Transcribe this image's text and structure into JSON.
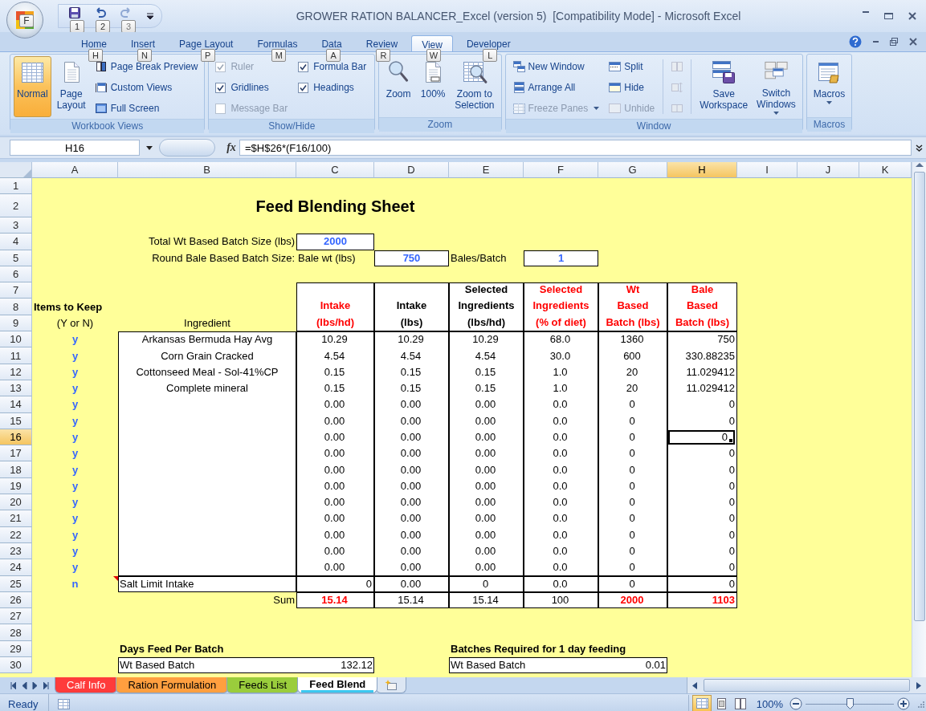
{
  "app_button": {
    "key_tip": "F"
  },
  "quick_access": [
    {
      "key_tip": "1",
      "disabled": false
    },
    {
      "key_tip": "2",
      "disabled": false
    },
    {
      "key_tip": "3",
      "disabled": true
    }
  ],
  "window": {
    "title": "GROWER RATION BALANCER_Excel (version 5)  [Compatibility Mode] - Microsoft Excel"
  },
  "tabs": [
    {
      "label": "Home",
      "key_tip": "H",
      "selected": false
    },
    {
      "label": "Insert",
      "key_tip": "N",
      "selected": false
    },
    {
      "label": "Page Layout",
      "key_tip": "P",
      "selected": false
    },
    {
      "label": "Formulas",
      "key_tip": "M",
      "selected": false
    },
    {
      "label": "Data",
      "key_tip": "A",
      "selected": false
    },
    {
      "label": "Review",
      "key_tip": "R",
      "selected": false
    },
    {
      "label": "View",
      "key_tip": "W",
      "selected": true
    },
    {
      "label": "Developer",
      "key_tip": "L",
      "selected": false
    }
  ],
  "ribbon_groups": [
    {
      "title": "Workbook Views",
      "items": [
        {
          "kind": "large",
          "lines": [
            "Normal"
          ],
          "selected": true,
          "disabled": false,
          "dropdown": false
        },
        {
          "kind": "large",
          "lines": [
            "Page",
            "Layout"
          ],
          "selected": false,
          "disabled": false,
          "dropdown": false
        },
        {
          "kind": "small",
          "label": "Page Break Preview",
          "disabled": false,
          "dropdown": false
        },
        {
          "kind": "small",
          "label": "Custom Views",
          "disabled": false,
          "dropdown": false
        },
        {
          "kind": "small",
          "label": "Full Screen",
          "disabled": false,
          "dropdown": false
        }
      ]
    },
    {
      "title": "Show/Hide",
      "items": [
        {
          "kind": "check",
          "label": "Ruler",
          "checked": true,
          "disabled": true
        },
        {
          "kind": "check",
          "label": "Gridlines",
          "checked": true,
          "disabled": false
        },
        {
          "kind": "check",
          "label": "Message Bar",
          "checked": false,
          "disabled": true
        },
        {
          "kind": "check",
          "label": "Formula Bar",
          "checked": true,
          "disabled": false
        },
        {
          "kind": "check",
          "label": "Headings",
          "checked": true,
          "disabled": false
        }
      ]
    },
    {
      "title": "Zoom",
      "items": [
        {
          "kind": "large",
          "lines": [
            "Zoom"
          ],
          "disabled": false,
          "dropdown": false
        },
        {
          "kind": "large",
          "lines": [
            "100%"
          ],
          "disabled": false,
          "dropdown": false
        },
        {
          "kind": "large",
          "lines": [
            "Zoom to",
            "Selection"
          ],
          "disabled": false,
          "dropdown": false
        }
      ]
    },
    {
      "title": "Window",
      "items": [
        {
          "kind": "small",
          "label": "New Window",
          "disabled": false,
          "dropdown": false
        },
        {
          "kind": "small",
          "label": "Arrange All",
          "disabled": false,
          "dropdown": false
        },
        {
          "kind": "small",
          "label": "Freeze Panes",
          "disabled": true,
          "dropdown": true
        },
        {
          "kind": "small",
          "label": "Split",
          "disabled": false,
          "dropdown": false
        },
        {
          "kind": "small",
          "label": "Hide",
          "disabled": false,
          "dropdown": false
        },
        {
          "kind": "small",
          "label": "Unhide",
          "disabled": true,
          "dropdown": false
        },
        {
          "kind": "icon",
          "disabled": true
        },
        {
          "kind": "icon",
          "disabled": true
        },
        {
          "kind": "icon",
          "disabled": true
        },
        {
          "kind": "large",
          "lines": [
            "Save",
            "Workspace"
          ],
          "disabled": false,
          "dropdown": false
        },
        {
          "kind": "large",
          "lines": [
            "Switch",
            "Windows"
          ],
          "disabled": false,
          "dropdown": true
        }
      ]
    },
    {
      "title": "Macros",
      "items": [
        {
          "kind": "large",
          "lines": [
            "Macros"
          ],
          "disabled": false,
          "dropdown": true
        }
      ]
    }
  ],
  "formula_bar": {
    "name_box": "H16",
    "function_button": "fx",
    "formula": "=$H$26*(F16/100)"
  },
  "sheet": {
    "columns": [
      {
        "label": "A",
        "selected": false
      },
      {
        "label": "B",
        "selected": false
      },
      {
        "label": "C",
        "selected": false
      },
      {
        "label": "D",
        "selected": false
      },
      {
        "label": "E",
        "selected": false
      },
      {
        "label": "F",
        "selected": false
      },
      {
        "label": "G",
        "selected": false
      },
      {
        "label": "H",
        "selected": true
      },
      {
        "label": "I",
        "selected": false
      },
      {
        "label": "J",
        "selected": false
      },
      {
        "label": "K",
        "selected": false
      }
    ],
    "row_numbers": [
      {
        "label": "1",
        "selected": false
      },
      {
        "label": "2",
        "selected": false
      },
      {
        "label": "3",
        "selected": false
      },
      {
        "label": "4",
        "selected": false
      },
      {
        "label": "5",
        "selected": false
      },
      {
        "label": "6",
        "selected": false
      },
      {
        "label": "7",
        "selected": false
      },
      {
        "label": "8",
        "selected": false
      },
      {
        "label": "9",
        "selected": false
      },
      {
        "label": "10",
        "selected": false
      },
      {
        "label": "11",
        "selected": false
      },
      {
        "label": "12",
        "selected": false
      },
      {
        "label": "13",
        "selected": false
      },
      {
        "label": "14",
        "selected": false
      },
      {
        "label": "15",
        "selected": false
      },
      {
        "label": "16",
        "selected": true
      },
      {
        "label": "17",
        "selected": false
      },
      {
        "label": "18",
        "selected": false
      },
      {
        "label": "19",
        "selected": false
      },
      {
        "label": "20",
        "selected": false
      },
      {
        "label": "21",
        "selected": false
      },
      {
        "label": "22",
        "selected": false
      },
      {
        "label": "23",
        "selected": false
      },
      {
        "label": "24",
        "selected": false
      },
      {
        "label": "25",
        "selected": false
      },
      {
        "label": "26",
        "selected": false
      },
      {
        "label": "27",
        "selected": false
      },
      {
        "label": "28",
        "selected": false
      },
      {
        "label": "29",
        "selected": false
      },
      {
        "label": "30",
        "selected": false
      }
    ],
    "title": "Feed Blending Sheet",
    "batch_size": {
      "label": "Total Wt Based Batch Size (lbs)",
      "value": "2000"
    },
    "bale_batch": {
      "label": "Round Bale Based Batch Size:",
      "weight_label": "Bale wt (lbs)",
      "weight": "750",
      "bales_label": "Bales/Batch",
      "bales": "1"
    },
    "keep_heading": {
      "title": "Items to Keep",
      "hint": "(Y or N)"
    },
    "ingredient_heading": "Ingredient",
    "table_columns": [
      {
        "lines": [
          "Intake",
          "(lbs/hd)"
        ],
        "highlighted": true
      },
      {
        "lines": [
          "Intake",
          "(lbs)"
        ],
        "highlighted": false
      },
      {
        "lines": [
          "Selected",
          "Ingredients",
          "(lbs/hd)"
        ],
        "highlighted": false
      },
      {
        "lines": [
          "Selected",
          "Ingredients",
          "(% of diet)"
        ],
        "highlighted": true
      },
      {
        "lines": [
          "Wt",
          "Based",
          "Batch (lbs)"
        ],
        "highlighted": true
      },
      {
        "lines": [
          "Bale",
          "Based",
          "Batch (lbs)"
        ],
        "highlighted": true
      }
    ],
    "table_rows": [
      {
        "kind": "ingredient",
        "keep": "y",
        "has_comment": false,
        "ingredient": "Arkansas Bermuda Hay Avg",
        "values": [
          {
            "text": "10.29",
            "selected": false
          },
          {
            "text": "10.29",
            "selected": false
          },
          {
            "text": "10.29",
            "selected": false
          },
          {
            "text": "68.0",
            "selected": false
          },
          {
            "text": "1360",
            "selected": false
          },
          {
            "text": "750",
            "selected": false
          }
        ]
      },
      {
        "kind": "ingredient",
        "keep": "y",
        "has_comment": false,
        "ingredient": "Corn Grain Cracked",
        "values": [
          {
            "text": "4.54",
            "selected": false
          },
          {
            "text": "4.54",
            "selected": false
          },
          {
            "text": "4.54",
            "selected": false
          },
          {
            "text": "30.0",
            "selected": false
          },
          {
            "text": "600",
            "selected": false
          },
          {
            "text": "330.88235",
            "selected": false
          }
        ]
      },
      {
        "kind": "ingredient",
        "keep": "y",
        "has_comment": false,
        "ingredient": "Cottonseed Meal - Sol-41%CP",
        "values": [
          {
            "text": "0.15",
            "selected": false
          },
          {
            "text": "0.15",
            "selected": false
          },
          {
            "text": "0.15",
            "selected": false
          },
          {
            "text": "1.0",
            "selected": false
          },
          {
            "text": "20",
            "selected": false
          },
          {
            "text": "11.029412",
            "selected": false
          }
        ]
      },
      {
        "kind": "ingredient",
        "keep": "y",
        "has_comment": false,
        "ingredient": "Complete mineral",
        "values": [
          {
            "text": "0.15",
            "selected": false
          },
          {
            "text": "0.15",
            "selected": false
          },
          {
            "text": "0.15",
            "selected": false
          },
          {
            "text": "1.0",
            "selected": false
          },
          {
            "text": "20",
            "selected": false
          },
          {
            "text": "11.029412",
            "selected": false
          }
        ]
      },
      {
        "kind": "ingredient",
        "keep": "y",
        "has_comment": false,
        "values": [
          {
            "text": "0.00",
            "selected": false
          },
          {
            "text": "0.00",
            "selected": false
          },
          {
            "text": "0.00",
            "selected": false
          },
          {
            "text": "0.0",
            "selected": false
          },
          {
            "text": "0",
            "selected": false
          },
          {
            "text": "0",
            "selected": false
          }
        ]
      },
      {
        "kind": "ingredient",
        "keep": "y",
        "has_comment": false,
        "values": [
          {
            "text": "0.00",
            "selected": false
          },
          {
            "text": "0.00",
            "selected": false
          },
          {
            "text": "0.00",
            "selected": false
          },
          {
            "text": "0.0",
            "selected": false
          },
          {
            "text": "0",
            "selected": false
          },
          {
            "text": "0",
            "selected": false
          }
        ]
      },
      {
        "kind": "ingredient",
        "keep": "y",
        "has_comment": false,
        "values": [
          {
            "text": "0.00",
            "selected": false
          },
          {
            "text": "0.00",
            "selected": false
          },
          {
            "text": "0.00",
            "selected": false
          },
          {
            "text": "0.0",
            "selected": false
          },
          {
            "text": "0",
            "selected": false
          },
          {
            "text": "0",
            "selected": true
          }
        ]
      },
      {
        "kind": "ingredient",
        "keep": "y",
        "has_comment": false,
        "values": [
          {
            "text": "0.00",
            "selected": false
          },
          {
            "text": "0.00",
            "selected": false
          },
          {
            "text": "0.00",
            "selected": false
          },
          {
            "text": "0.0",
            "selected": false
          },
          {
            "text": "0",
            "selected": false
          },
          {
            "text": "0",
            "selected": false
          }
        ]
      },
      {
        "kind": "ingredient",
        "keep": "y",
        "has_comment": false,
        "values": [
          {
            "text": "0.00",
            "selected": false
          },
          {
            "text": "0.00",
            "selected": false
          },
          {
            "text": "0.00",
            "selected": false
          },
          {
            "text": "0.0",
            "selected": false
          },
          {
            "text": "0",
            "selected": false
          },
          {
            "text": "0",
            "selected": false
          }
        ]
      },
      {
        "kind": "ingredient",
        "keep": "y",
        "has_comment": false,
        "values": [
          {
            "text": "0.00",
            "selected": false
          },
          {
            "text": "0.00",
            "selected": false
          },
          {
            "text": "0.00",
            "selected": false
          },
          {
            "text": "0.0",
            "selected": false
          },
          {
            "text": "0",
            "selected": false
          },
          {
            "text": "0",
            "selected": false
          }
        ]
      },
      {
        "kind": "ingredient",
        "keep": "y",
        "has_comment": false,
        "values": [
          {
            "text": "0.00",
            "selected": false
          },
          {
            "text": "0.00",
            "selected": false
          },
          {
            "text": "0.00",
            "selected": false
          },
          {
            "text": "0.0",
            "selected": false
          },
          {
            "text": "0",
            "selected": false
          },
          {
            "text": "0",
            "selected": false
          }
        ]
      },
      {
        "kind": "ingredient",
        "keep": "y",
        "has_comment": false,
        "values": [
          {
            "text": "0.00",
            "selected": false
          },
          {
            "text": "0.00",
            "selected": false
          },
          {
            "text": "0.00",
            "selected": false
          },
          {
            "text": "0.0",
            "selected": false
          },
          {
            "text": "0",
            "selected": false
          },
          {
            "text": "0",
            "selected": false
          }
        ]
      },
      {
        "kind": "ingredient",
        "keep": "y",
        "has_comment": false,
        "values": [
          {
            "text": "0.00",
            "selected": false
          },
          {
            "text": "0.00",
            "selected": false
          },
          {
            "text": "0.00",
            "selected": false
          },
          {
            "text": "0.0",
            "selected": false
          },
          {
            "text": "0",
            "selected": false
          },
          {
            "text": "0",
            "selected": false
          }
        ]
      },
      {
        "kind": "ingredient",
        "keep": "y",
        "has_comment": false,
        "values": [
          {
            "text": "0.00",
            "selected": false
          },
          {
            "text": "0.00",
            "selected": false
          },
          {
            "text": "0.00",
            "selected": false
          },
          {
            "text": "0.0",
            "selected": false
          },
          {
            "text": "0",
            "selected": false
          },
          {
            "text": "0",
            "selected": false
          }
        ]
      },
      {
        "kind": "ingredient",
        "keep": "y",
        "has_comment": false,
        "values": [
          {
            "text": "0.00",
            "selected": false
          },
          {
            "text": "0.00",
            "selected": false
          },
          {
            "text": "0.00",
            "selected": false
          },
          {
            "text": "0.0",
            "selected": false
          },
          {
            "text": "0",
            "selected": false
          },
          {
            "text": "0",
            "selected": false
          }
        ]
      },
      {
        "kind": "limit",
        "keep": "n",
        "has_comment": true,
        "ingredient": "Salt Limit Intake",
        "values": [
          {
            "text": "0",
            "selected": false
          },
          {
            "text": "0.00",
            "selected": false
          },
          {
            "text": "0",
            "selected": false
          },
          {
            "text": "0.0",
            "selected": false
          },
          {
            "text": "0",
            "selected": false
          },
          {
            "text": "0",
            "selected": false
          }
        ]
      }
    ],
    "sum_row": {
      "label": "Sum",
      "values": [
        {
          "text": "15.14",
          "highlighted": true
        },
        {
          "text": "15.14",
          "highlighted": false
        },
        {
          "text": "15.14",
          "highlighted": false
        },
        {
          "text": "100",
          "highlighted": false
        },
        {
          "text": "2000",
          "highlighted": true
        },
        {
          "text": "1103",
          "highlighted": true
        }
      ]
    },
    "days_feed": {
      "title": "Days Feed Per Batch",
      "label": "Wt Based Batch",
      "value": "132.12"
    },
    "batches_required": {
      "title": "Batches Required for 1 day feeding",
      "label": "Wt Based Batch",
      "value": "0.01"
    }
  },
  "sheet_tabs": [
    {
      "label": "Calf Info",
      "color": "#ff3b3b",
      "selected": false
    },
    {
      "label": "Ration Formulation",
      "color": "#ff9f3f",
      "selected": false
    },
    {
      "label": "Feeds List",
      "color": "#9acd3c",
      "selected": false
    },
    {
      "label": "Feed Blend",
      "color": "#3cc8f0",
      "selected": true
    }
  ],
  "status_bar": {
    "text": "Ready",
    "views": [
      {
        "selected": true
      },
      {
        "selected": false
      },
      {
        "selected": false
      }
    ],
    "zoom": {
      "label": "100%",
      "level": 0.5
    }
  }
}
